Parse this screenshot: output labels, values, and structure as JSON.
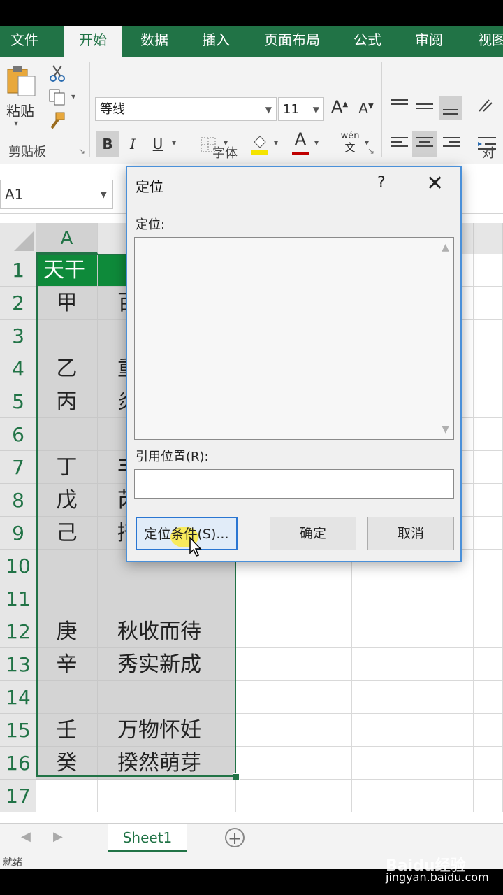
{
  "ribbon_tabs": [
    "文件",
    "开始",
    "数据",
    "插入",
    "页面布局",
    "公式",
    "审阅",
    "视图"
  ],
  "ribbon": {
    "paste_label": "粘贴",
    "clipboard_group": "剪贴板",
    "font_group": "字体",
    "align_group": "对齐",
    "font_name": "等线",
    "font_size": "11",
    "bold": "B",
    "italic": "I",
    "underline": "U",
    "grow_font": "A",
    "shrink_font": "A",
    "font_color": "A",
    "phonetic_top": "wén",
    "phonetic_bottom": "文"
  },
  "name_box": "A1",
  "columns": [
    "A"
  ],
  "rows": [
    "1",
    "2",
    "3",
    "4",
    "5",
    "6",
    "7",
    "8",
    "9",
    "10",
    "11",
    "12",
    "13",
    "14",
    "15",
    "16",
    "17"
  ],
  "cells_a": [
    "天干",
    "甲",
    "",
    "乙",
    "丙",
    "",
    "丁",
    "戊",
    "己",
    "",
    "",
    "庚",
    "辛",
    "",
    "壬",
    "癸",
    ""
  ],
  "cells_b": [
    "",
    "百",
    "",
    "重",
    "炎",
    "",
    "丰",
    "芮",
    "掊",
    "",
    "",
    "秋收而待",
    "秀实新成",
    "",
    "万物怀妊",
    "揆然萌芽",
    ""
  ],
  "sheet_tab": "Sheet1",
  "status": "就绪",
  "dialog": {
    "title": "定位",
    "help": "?",
    "close": "✕",
    "goto_label": "定位:",
    "reference_label": "引用位置(R):",
    "reference_value": "",
    "special_button": "定位条件(S)...",
    "ok_button": "确定",
    "cancel_button": "取消"
  },
  "watermark": {
    "brand": "Baidu经验",
    "url": "jingyan.baidu.com"
  }
}
